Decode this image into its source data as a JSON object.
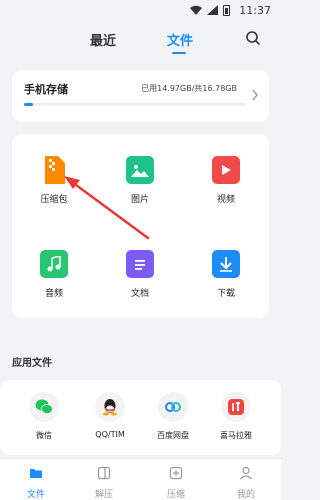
{
  "status_bar": {
    "time": "11:37"
  },
  "top_tabs": [
    {
      "label": "最近"
    },
    {
      "label": "文件"
    }
  ],
  "storage": {
    "title": "手机存储",
    "usage": "已用14.97GB/共16.78GB",
    "used_fraction": 0.04
  },
  "categories": [
    {
      "label": "压缩包",
      "icon": "zip-icon",
      "color": "#ff8a00"
    },
    {
      "label": "图片",
      "icon": "image-icon",
      "color": "#1fc28a"
    },
    {
      "label": "视频",
      "icon": "video-icon",
      "color": "#f24a4a"
    },
    {
      "label": "音频",
      "icon": "music-icon",
      "color": "#28c76f"
    },
    {
      "label": "文档",
      "icon": "document-icon",
      "color": "#7b5cf5"
    },
    {
      "label": "下载",
      "icon": "download-icon",
      "color": "#1d8cf8"
    }
  ],
  "apps_section": {
    "title": "应用文件",
    "apps": [
      {
        "label": "微信",
        "icon": "wechat-icon",
        "color": "#22c35e"
      },
      {
        "label": "QQ/TIM",
        "icon": "qq-icon",
        "color": "#222222"
      },
      {
        "label": "百度网盘",
        "icon": "baidu-netdisk-icon",
        "color": "#2e7df6"
      },
      {
        "label": "喜马拉雅",
        "icon": "ximalaya-icon",
        "color": "#f2473a"
      }
    ]
  },
  "bottom_nav": [
    {
      "label": "文件",
      "icon": "folder-icon",
      "active": true
    },
    {
      "label": "解压",
      "icon": "unzip-icon",
      "active": false
    },
    {
      "label": "压缩",
      "icon": "compress-icon",
      "active": false
    },
    {
      "label": "我的",
      "icon": "profile-icon",
      "active": false
    }
  ],
  "colors": {
    "accent": "#1d8cf8",
    "annotation_arrow": "#e53935"
  }
}
